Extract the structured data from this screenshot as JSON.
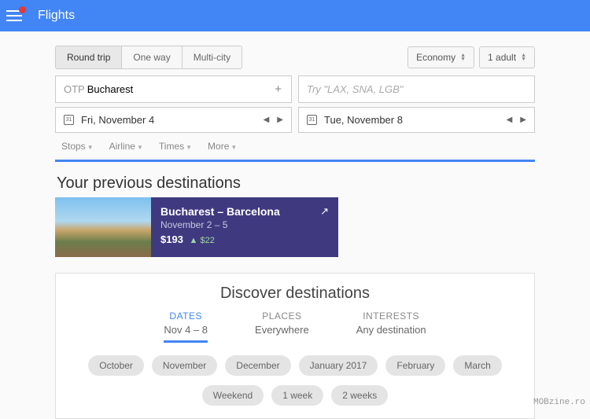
{
  "header": {
    "title": "Flights"
  },
  "trip_tabs": {
    "round": "Round trip",
    "oneway": "One way",
    "multi": "Multi-city"
  },
  "options": {
    "cabin": "Economy",
    "pax": "1 adult"
  },
  "origin": {
    "code": "OTP",
    "city": "Bucharest"
  },
  "destination": {
    "placeholder": "Try \"LAX, SNA, LGB\""
  },
  "dates": {
    "depart": "Fri, November 4",
    "return": "Tue, November 8"
  },
  "filters": {
    "stops": "Stops",
    "airline": "Airline",
    "times": "Times",
    "more": "More"
  },
  "previous": {
    "heading": "Your previous destinations",
    "card": {
      "route": "Bucharest – Barcelona",
      "dates": "November 2 – 5",
      "price": "$193",
      "change": "▲ $22"
    }
  },
  "discover": {
    "heading": "Discover destinations",
    "tabs": {
      "dates": {
        "label": "DATES",
        "value": "Nov 4 – 8"
      },
      "places": {
        "label": "PLACES",
        "value": "Everywhere"
      },
      "interests": {
        "label": "INTERESTS",
        "value": "Any destination"
      }
    },
    "months": {
      "m0": "October",
      "m1": "November",
      "m2": "December",
      "m3": "January 2017",
      "m4": "February",
      "m5": "March"
    },
    "durations": {
      "d0": "Weekend",
      "d1": "1 week",
      "d2": "2 weeks"
    }
  },
  "watermark": "MOBzine.ro"
}
